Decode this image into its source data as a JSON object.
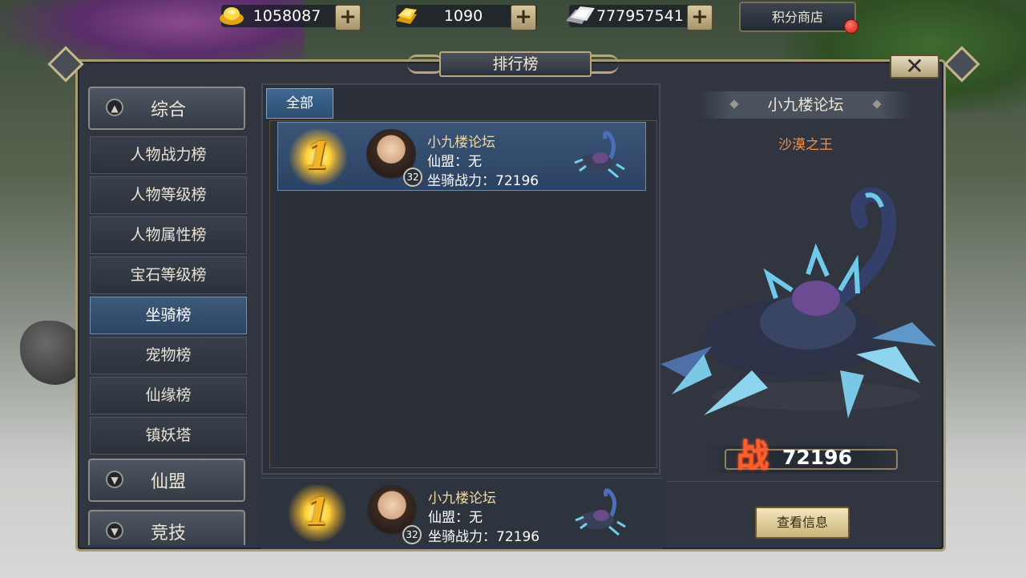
{
  "currencies": [
    {
      "icon": "gold-ingot-icon",
      "value": "1058087"
    },
    {
      "icon": "gold-bar-stack-icon",
      "value": "1090"
    },
    {
      "icon": "silver-ingot-icon",
      "value": "777957541"
    }
  ],
  "plus_label": "+",
  "shop_label": "积分商店",
  "window_title": "排行榜",
  "close_label": "✕",
  "categories": {
    "general": {
      "label": "综合",
      "expanded": true
    },
    "items": [
      {
        "label": "人物战力榜"
      },
      {
        "label": "人物等级榜"
      },
      {
        "label": "人物属性榜"
      },
      {
        "label": "宝石等级榜"
      },
      {
        "label": "坐骑榜",
        "active": true
      },
      {
        "label": "宠物榜"
      },
      {
        "label": "仙缘榜"
      },
      {
        "label": "镇妖塔"
      }
    ],
    "alliance": {
      "label": "仙盟",
      "expanded": false
    },
    "arena": {
      "label": "竞技",
      "expanded": false
    }
  },
  "filter_tab": "全部",
  "ranking": [
    {
      "rank": "1",
      "name": "小九楼论坛",
      "level": "32",
      "alliance_line": "仙盟：无",
      "power_line": "坐骑战力：72196"
    }
  ],
  "my_entry": {
    "rank": "1",
    "name": "小九楼论坛",
    "level": "32",
    "alliance_line": "仙盟：无",
    "power_line": "坐骑战力：72196"
  },
  "preview": {
    "player_name": "小九楼论坛",
    "mount_title": "沙漠之王",
    "power_glyph": "战",
    "power_value": "72196",
    "view_info_label": "查看信息"
  },
  "colors": {
    "accent_gold": "#f3b423",
    "active_blue": "#3d5a7a",
    "title_orange": "#f2914a",
    "frame_gold": "#a89b78"
  }
}
